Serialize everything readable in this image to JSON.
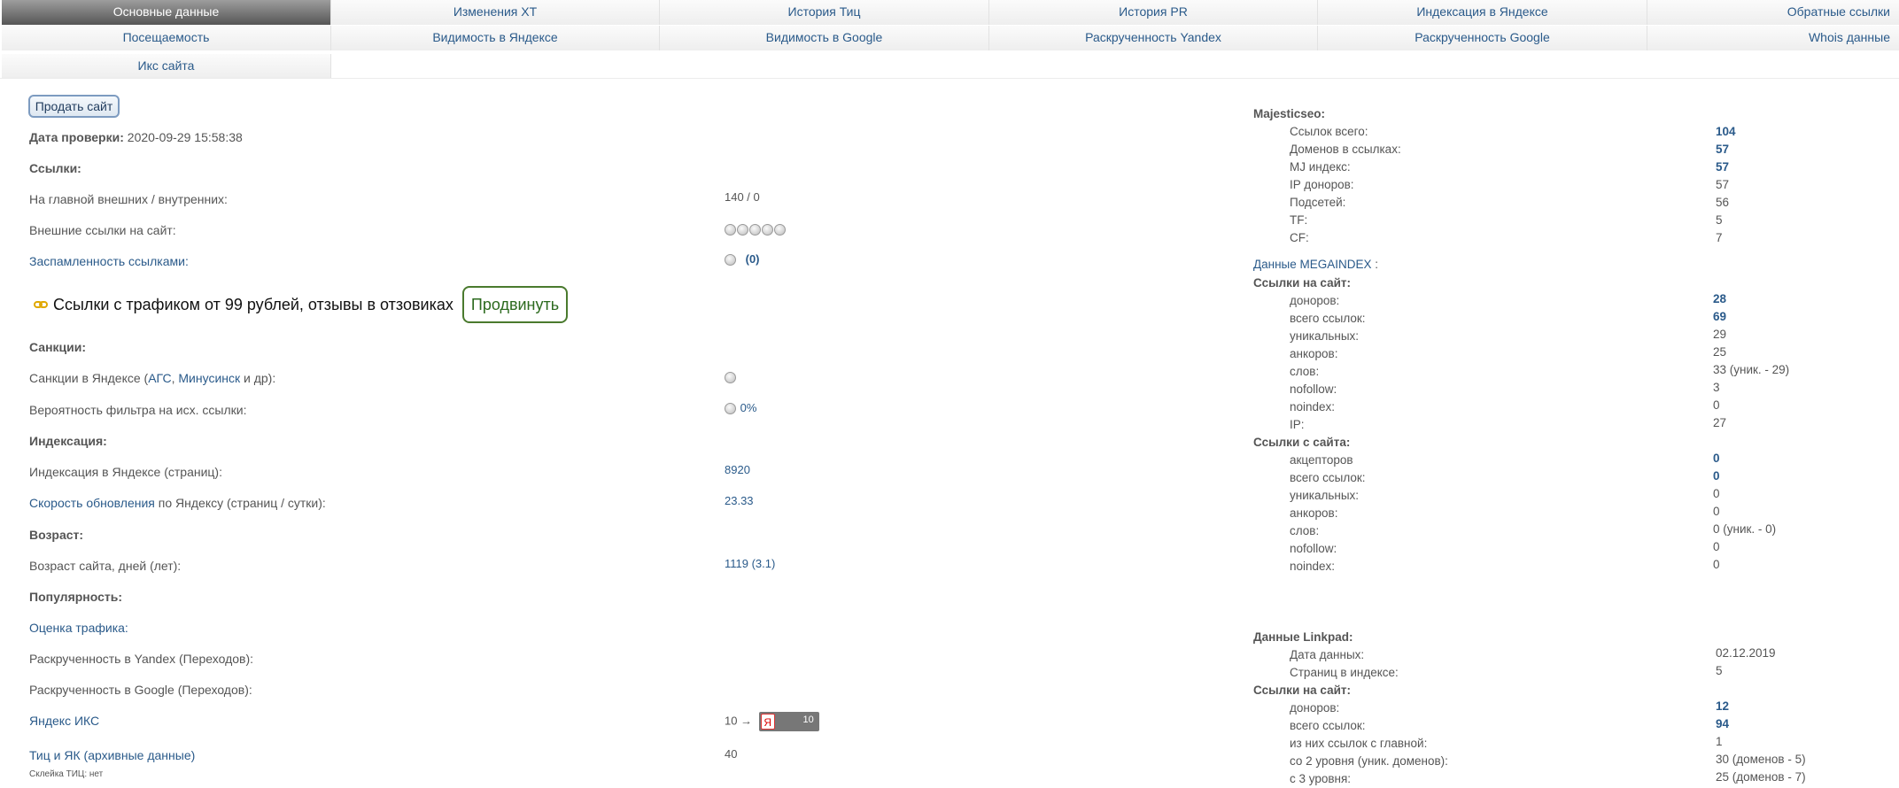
{
  "nav": {
    "row1": [
      "Основные данные",
      "Изменения ХТ",
      "История Тиц",
      "История PR",
      "Индексация в Яндексе",
      "Обратные ссылки"
    ],
    "row2": [
      "Посещаемость",
      "Видимость в Яндексе",
      "Видимость в Google",
      "Раскрученность Yandex",
      "Раскрученность Google",
      "Whois данные"
    ],
    "row3": [
      "Икс сайта"
    ]
  },
  "left": {
    "sell_button": "Продать сайт",
    "check_date_label": "Дата проверки:",
    "check_date_value": "2020-09-29 15:58:38",
    "links_header": "Ссылки:",
    "main_links_label": "На главной внешних / внутренних:",
    "main_links_value": "140 / 0",
    "external_links_label": "Внешние ссылки на сайт:",
    "spam_label": "Заспамленность ссылками",
    "spam_colon": ":",
    "spam_value": "(0)",
    "promo_text": "Ссылки с трафиком от 99 рублей, отзывы в отзовиках",
    "promo_button": "Продвинуть",
    "sanctions_header": "Санкции:",
    "sanctions_pre": "Санкции в Яндексе (",
    "sanctions_ags": "АГС",
    "sanctions_comma": ", ",
    "sanctions_minusinsk": "Минусинск",
    "sanctions_post": " и др):",
    "filter_label": "Вероятность фильтра на исх. ссылки:",
    "filter_value": "0%",
    "indexing_header": "Индексация:",
    "yandex_index_label": "Индексация в Яндексе (страниц):",
    "yandex_index_value": "8920",
    "update_speed_link": "Скорость обновления",
    "update_speed_rest": " по Яндексу (страниц / сутки):",
    "update_speed_value": "23.33",
    "age_header": "Возраст:",
    "age_label": "Возраст сайта, дней (лет):",
    "age_value": "1119 (3.1)",
    "popularity_header": "Популярность:",
    "traffic_label": "Оценка трафика",
    "traffic_colon": ":",
    "yandex_promo_label": "Раскрученность в Yandex (Переходов):",
    "google_promo_label": "Раскрученность в Google (Переходов):",
    "yandex_iks_label": "Яндекс ИКС",
    "yandex_iks_value": "10 →",
    "yandex_iks_badge_letter": "Я",
    "yandex_iks_badge_num": "10",
    "tic_label": "Тиц и ЯК (архивные данные)",
    "tic_value": "40",
    "glue_label": "Склейка ТИЦ: нет"
  },
  "right": {
    "majestic_header": "Majesticseo:",
    "majestic": [
      {
        "label": "Ссылок всего:",
        "value": "104",
        "link": true
      },
      {
        "label": "Доменов в ссылках:",
        "value": "57",
        "link": true
      },
      {
        "label": "MJ индекс:",
        "value": "57",
        "link": true
      },
      {
        "label": "IP доноров:",
        "value": "57",
        "link": false
      },
      {
        "label": "Подсетей:",
        "value": "56",
        "link": false
      },
      {
        "label": "TF:",
        "value": "5",
        "link": false
      },
      {
        "label": "CF:",
        "value": "7",
        "link": false
      }
    ],
    "megaindex_header": "Данные MEGAINDEX",
    "megaindex_colon": " :",
    "mega_in_header": "Ссылки на сайт:",
    "mega_in": [
      {
        "label": "доноров:",
        "value": "28",
        "link": true
      },
      {
        "label": "всего ссылок:",
        "value": "69",
        "link": true
      },
      {
        "label": "уникальных:",
        "value": "29",
        "link": false
      },
      {
        "label": "анкоров:",
        "value": "25",
        "link": false
      },
      {
        "label": "слов:",
        "value": "33 (уник. - 29)",
        "link": false
      },
      {
        "label": "nofollow:",
        "value": "3",
        "link": false
      },
      {
        "label": "noindex:",
        "value": "0",
        "link": false
      },
      {
        "label": "IP:",
        "value": "27",
        "link": false
      }
    ],
    "mega_out_header": "Ссылки с сайта:",
    "mega_out": [
      {
        "label": "акцепторов",
        "value": "0",
        "link": true
      },
      {
        "label": "всего ссылок:",
        "value": "0",
        "link": true
      },
      {
        "label": "уникальных:",
        "value": "0",
        "link": false
      },
      {
        "label": "анкоров:",
        "value": "0",
        "link": false
      },
      {
        "label": "слов:",
        "value": "0 (уник. - 0)",
        "link": false
      },
      {
        "label": "nofollow:",
        "value": "0",
        "link": false
      },
      {
        "label": "noindex:",
        "value": "0",
        "link": false
      }
    ],
    "linkpad_header": "Данные Linkpad:",
    "linkpad": [
      {
        "label": "Дата данных:",
        "value": "02.12.2019",
        "link": false
      },
      {
        "label": "Страниц в индексе:",
        "value": "5",
        "link": false
      }
    ],
    "linkpad_in_header": "Ссылки на сайт:",
    "linkpad_in": [
      {
        "label": "доноров:",
        "value": "12",
        "link": true
      },
      {
        "label": "всего ссылок:",
        "value": "94",
        "link": true
      },
      {
        "label": "из них ссылок с главной:",
        "value": "1",
        "link": false
      },
      {
        "label": "со 2 уровня (уник. доменов):",
        "value": "30 (доменов - 5)",
        "link": false
      },
      {
        "label": "с 3 уровня:",
        "value": "25 (доменов - 7)",
        "link": false
      }
    ]
  }
}
